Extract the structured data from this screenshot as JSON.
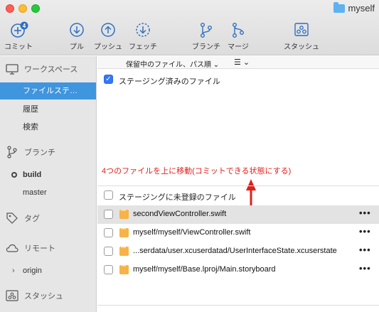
{
  "window": {
    "repo_name": "myself"
  },
  "toolbar": {
    "commit": {
      "label": "コミット",
      "badge": "4"
    },
    "pull": {
      "label": "プル"
    },
    "push": {
      "label": "プッシュ"
    },
    "fetch": {
      "label": "フェッチ"
    },
    "branch": {
      "label": "ブランチ"
    },
    "merge": {
      "label": "マージ"
    },
    "stash": {
      "label": "スタッシュ"
    }
  },
  "sidebar": {
    "workspace_header": "ワークスペース",
    "workspace_items": [
      "ファイルステ…",
      "履歴",
      "検索"
    ],
    "branches_header": "ブランチ",
    "branches": [
      "build",
      "master"
    ],
    "tags_header": "タグ",
    "remotes_header": "リモート",
    "remotes": [
      "origin"
    ],
    "stash_header": "スタッシュ"
  },
  "main": {
    "sort_label": "保留中のファイル、パス順 ⌄",
    "view_mode_label": "☰ ⌄",
    "staged_title": "ステージング済みのファイル",
    "annotation": "4つのファイルを上に移動(コミットできる状態にする)",
    "unstaged_title": "ステージングに未登録のファイル",
    "files": [
      "secondViewController.swift",
      "myself/myself/ViewController.swift",
      "...serdata/user.xcuserdatad/UserInterfaceState.xcuserstate",
      "myself/myself/Base.lproj/Main.storyboard"
    ],
    "more_label": "•••"
  },
  "colors": {
    "accent": "#3f95de",
    "annotation": "#e0201b",
    "file_icon": "#f7b347"
  }
}
